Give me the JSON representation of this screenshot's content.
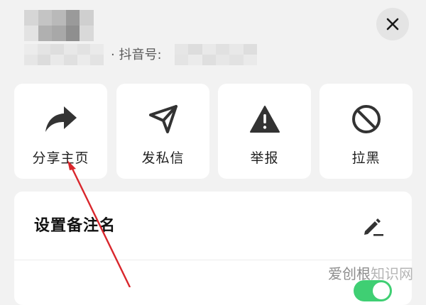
{
  "header": {
    "douyin_id_label": "· 抖音号:",
    "name_mosaic": [
      "#d6d6d6",
      "#c4c4c4",
      "#b9b9b9",
      "#9a9a9a",
      "#cfcfcf",
      "#e3e3e3",
      "#b0b0b0",
      "#a8a8a8",
      "#8f8f8f",
      "#d9d9d9"
    ],
    "sub_mosaic": [
      "#ececec",
      "#e4e4e4",
      "#dedede",
      "#e8e8e8",
      "#e2e2e2",
      "#eaeaea",
      "#e6e6e6",
      "#dcdcdc",
      "#e9e9e9",
      "#e0e0e0",
      "#ebebeb",
      "#e3e3e3"
    ],
    "id_mosaic": [
      "#e6e6e6",
      "#dddddd",
      "#e9e9e9",
      "#e1e1e1",
      "#e8e8e8",
      "#dedede",
      "#e4e4e4",
      "#ebebeb",
      "#dfdfdf",
      "#e7e7e7",
      "#e2e2e2",
      "#eaeaea"
    ],
    "close_icon": "close-icon"
  },
  "actions": [
    {
      "label": "分享主页",
      "icon": "share-arrow-icon"
    },
    {
      "label": "发私信",
      "icon": "paper-plane-icon"
    },
    {
      "label": "举报",
      "icon": "warning-triangle-icon"
    },
    {
      "label": "拉黑",
      "icon": "block-icon"
    }
  ],
  "settings": {
    "remark_label": "设置备注名",
    "remark_icon": "pencil-icon",
    "next_row_label": "",
    "toggle_on": true
  },
  "colors": {
    "background": "#f2f2f2",
    "card": "#ffffff",
    "icon": "#333333",
    "annotation": "#d9262c",
    "toggle": "#3fcf73"
  },
  "watermark": {
    "text_strong": "爱创根",
    "text": "知识网"
  }
}
